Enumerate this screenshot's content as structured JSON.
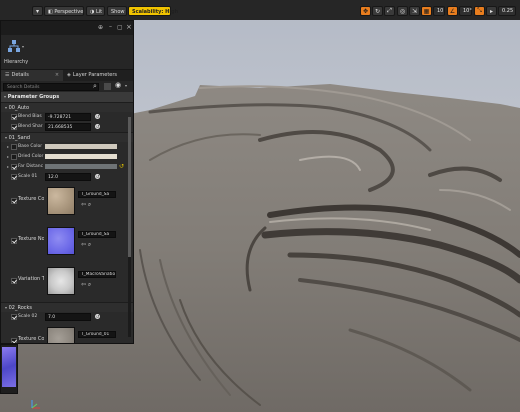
{
  "toolbar": {
    "perspective": "Perspective",
    "lit": "Lit",
    "show": "Show",
    "scalability": "Scalability: High",
    "snap_grid": "10",
    "snap_rotation": "10°",
    "camera_speed": "0.25",
    "accent_color": "#f0c300",
    "active_color": "#e87d1e"
  },
  "panel": {
    "hierarchy_label": "Hierarchy",
    "tabs": [
      {
        "label": "Details"
      },
      {
        "label": "Layer Parameters"
      }
    ],
    "search_placeholder": "Search Details",
    "section_title": "Parameter Groups",
    "groups": {
      "g0": "00_Auto",
      "g1": "01_Sand",
      "g2": "02_Rocks"
    },
    "rows": {
      "blend_bias_label": "Blend Bias",
      "blend_bias_value": "-9.728721",
      "blend_sharp_label": "Blend Shar",
      "blend_sharp_value": "21.668535",
      "base_color_label": "Base Color",
      "dried_color_label": "Dried Color",
      "far_distance_label": "Far Distanc",
      "scale01_label": "Scale 01",
      "scale01_value": "12.0",
      "texture_c_label": "Texture Co",
      "texture_c_value": "T_Ground_Sa",
      "texture_n_label": "Texture No",
      "texture_n_value": "T_Ground_Sa",
      "variation_label": "Variation T",
      "variation_value": "T_MacroVariation",
      "scale02_label": "Scale 02",
      "scale02_value": "7.0",
      "texture_c2_label": "Texture Co",
      "texture_c2_value": "T_Ground_01"
    }
  }
}
